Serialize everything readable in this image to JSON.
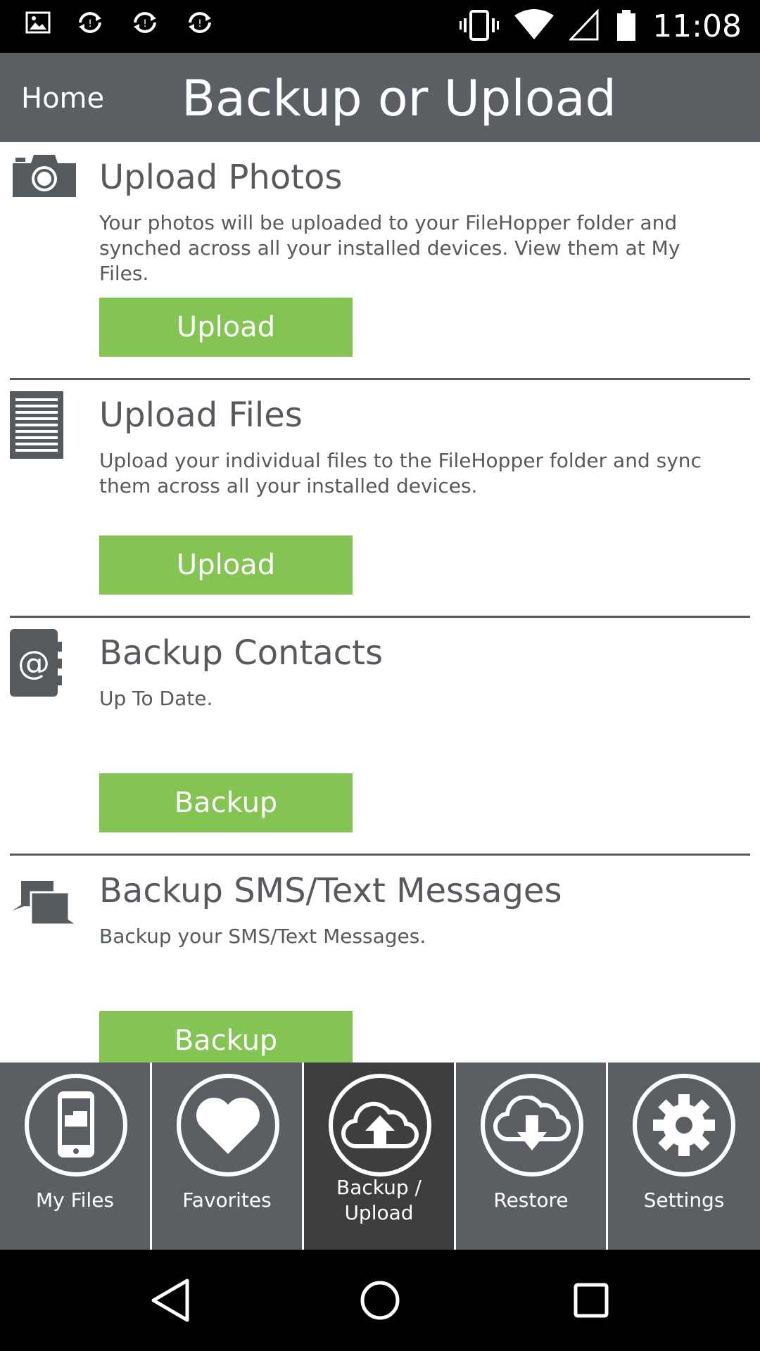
{
  "status_bar": {
    "time": "11:08",
    "left_icons": [
      "image-icon",
      "sync-icon",
      "sync-icon",
      "sync-icon"
    ],
    "right_icons": [
      "vibrate-icon",
      "wifi-icon",
      "cell-signal-icon",
      "battery-icon"
    ]
  },
  "action_bar": {
    "home_label": "Home",
    "title": "Backup or Upload"
  },
  "sections": [
    {
      "icon": "camera-icon",
      "title": "Upload Photos",
      "description": "Your photos will be uploaded to your FileHopper folder and synched across all your installed devices. View them at My Files.",
      "button_label": "Upload"
    },
    {
      "icon": "document-icon",
      "title": "Upload Files",
      "description": "Upload your individual files to the FileHopper folder and sync them across all your installed devices.",
      "button_label": "Upload"
    },
    {
      "icon": "contacts-book-icon",
      "title": "Backup Contacts",
      "description": "Up To Date.",
      "button_label": "Backup"
    },
    {
      "icon": "chat-bubbles-icon",
      "title": "Backup SMS/Text Messages",
      "description": "Backup your SMS/Text Messages.",
      "button_label": "Backup"
    }
  ],
  "tabs": [
    {
      "label": "My Files",
      "icon": "phone-icon",
      "active": false
    },
    {
      "label": "Favorites",
      "icon": "heart-icon",
      "active": false
    },
    {
      "label": "Backup / Upload",
      "icon": "cloud-upload-icon",
      "active": true
    },
    {
      "label": "Restore",
      "icon": "cloud-download-icon",
      "active": false
    },
    {
      "label": "Settings",
      "icon": "gear-icon",
      "active": false
    }
  ],
  "colors": {
    "accent_green": "#84c452",
    "header_gray": "#5b5f63",
    "active_tab": "#3c3e40",
    "text_gray": "#555a5e"
  }
}
